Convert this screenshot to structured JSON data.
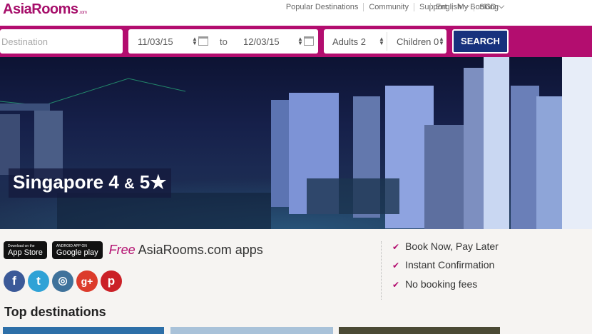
{
  "brand": {
    "logo": "AsiaRooms",
    "logo_suffix": ".com"
  },
  "topnav": {
    "items": [
      "Popular Destinations",
      "Community",
      "Support",
      "My Booking"
    ],
    "language": "English",
    "currency": "SGD"
  },
  "searchbar": {
    "destination_placeholder": "Destination",
    "checkin": "11/03/15",
    "to_label": "to",
    "checkout": "12/03/15",
    "adults": "Adults 2",
    "children": "Children 0",
    "search_button": "SEARCH"
  },
  "hero": {
    "title": "Singapore 4",
    "amp": "&",
    "title_end": "5★"
  },
  "apps": {
    "appstore_small": "Download on the",
    "appstore_big": "App Store",
    "googleplay_small": "ANDROID APP ON",
    "googleplay_big": "Google play",
    "free_word": "Free",
    "free_text": " AsiaRooms.com apps"
  },
  "social": [
    {
      "icon": "facebook-icon",
      "glyph": "f",
      "color": "#3b5998"
    },
    {
      "icon": "twitter-icon",
      "glyph": "t",
      "color": "#2fa2d6"
    },
    {
      "icon": "instagram-icon",
      "glyph": "◎",
      "color": "#3f729b"
    },
    {
      "icon": "googleplus-icon",
      "glyph": "g+",
      "color": "#dc3b2b"
    },
    {
      "icon": "pinterest-icon",
      "glyph": "p",
      "color": "#cb2027"
    }
  ],
  "features": [
    "Book Now, Pay Later",
    "Instant Confirmation",
    "No booking fees"
  ],
  "section": {
    "top_destinations": "Top destinations"
  },
  "colors": {
    "brand": "#b30d6f",
    "search": "#17317d"
  }
}
